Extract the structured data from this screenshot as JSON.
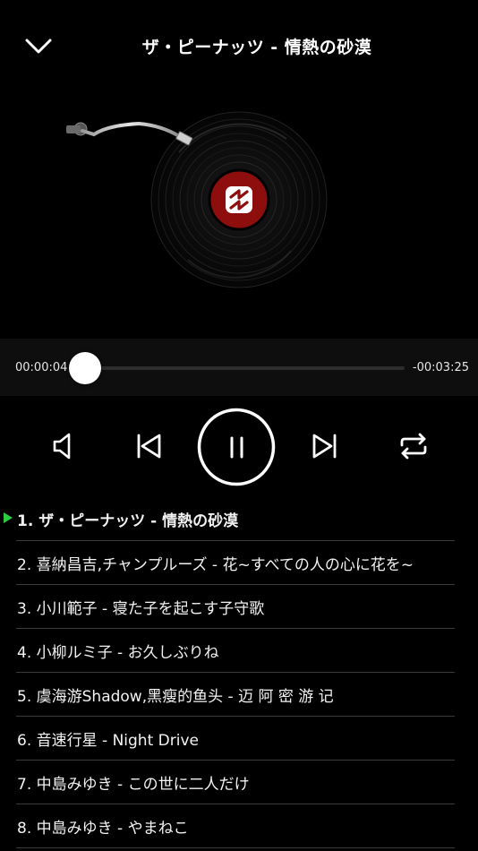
{
  "header": {
    "title": "ザ・ピーナッツ - 情熱の砂漠",
    "collapse_icon": "chevron-down-icon"
  },
  "disc": {
    "label_color": "#8e0d0d",
    "logo_icon": "music-app-logo-icon"
  },
  "progress": {
    "current_time": "00:00:04",
    "remaining_time": "-00:03:25",
    "fraction": 0.02,
    "accent_color": "#2f7cf6"
  },
  "controls": {
    "volume_icon": "speaker-icon",
    "previous_icon": "skip-previous-icon",
    "play_state_icon": "pause-icon",
    "next_icon": "skip-next-icon",
    "repeat_icon": "repeat-icon"
  },
  "playlist": {
    "now_playing_color": "#2ecc40",
    "items": [
      {
        "text": "1.  ザ・ピーナッツ - 情熱の砂漠",
        "active": true
      },
      {
        "text": "2.  喜納昌吉,チャンプルーズ - 花~すべての人の心に花を~"
      },
      {
        "text": "3.  小川範子 - 寝た子を起こす子守歌"
      },
      {
        "text": "4.  小柳ルミ子 - お久しぶりね"
      },
      {
        "text": "5.  虞海游Shadow,黑瘦的鱼头 - 迈 阿 密 游 记"
      },
      {
        "text": "6.  音速行星 - Night Drive"
      },
      {
        "text": "7.  中島みゆき - この世に二人だけ"
      },
      {
        "text": "8.  中島みゆき - やまねこ"
      }
    ]
  }
}
